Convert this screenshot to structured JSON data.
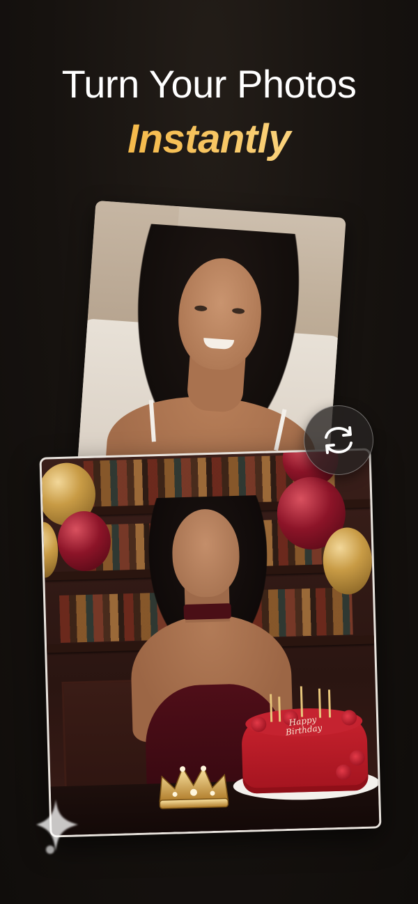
{
  "headline": {
    "line1": "Turn Your Photos",
    "line2": "Instantly"
  },
  "colors": {
    "background": "#16120f",
    "accent_gradient_start": "#f0a72a",
    "accent_gradient_end": "#fde7a8",
    "card_border": "#e9e4de"
  },
  "images": {
    "original_photo": "portrait-photo",
    "result_photo": "birthday-portrait-photo"
  },
  "cake_text": {
    "line1": "Happy",
    "line2": "Birthday"
  },
  "icons": {
    "swap": "swap-arrows-icon",
    "sparkle": "sparkle-icon"
  }
}
